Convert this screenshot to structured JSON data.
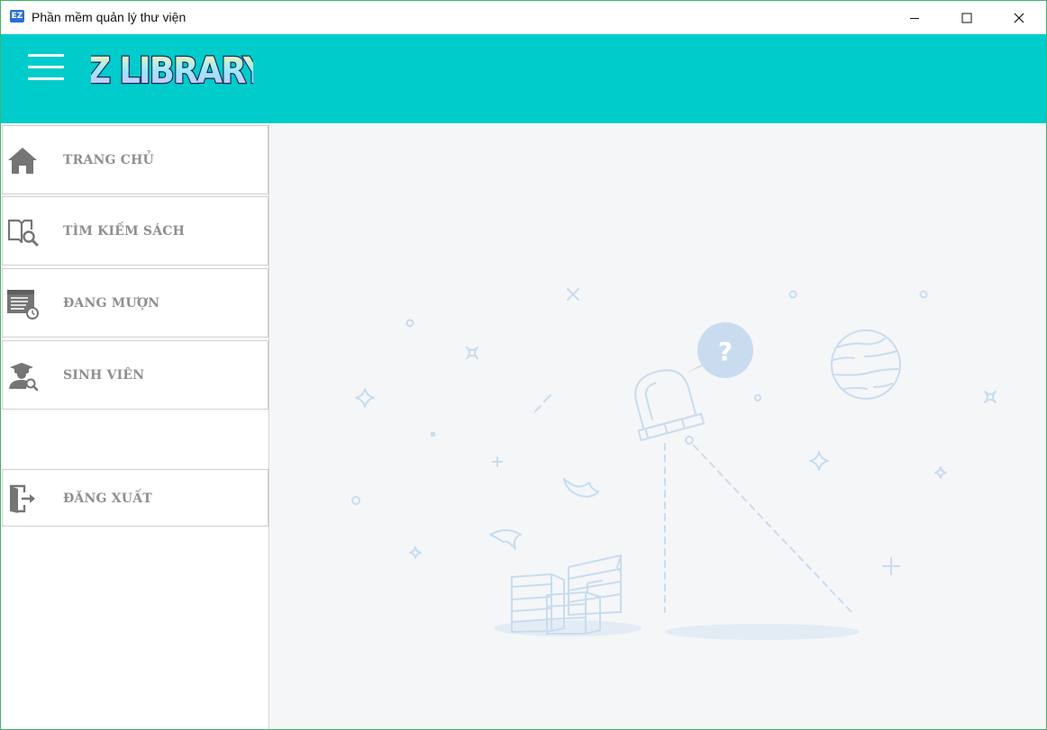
{
  "window": {
    "title": "Phần mềm quản lý thư viện",
    "icon_text": "EZ"
  },
  "header": {
    "logo_text": "EZ LIBRARY",
    "background": "#00cccc"
  },
  "sidebar": {
    "items": [
      {
        "label": "TRANG CHỦ",
        "icon": "home-icon"
      },
      {
        "label": "TÌM KIẾM SÁCH",
        "icon": "book-search-icon"
      },
      {
        "label": "ĐANG MƯỢN",
        "icon": "borrowed-list-icon"
      },
      {
        "label": "SINH VIÊN",
        "icon": "student-search-icon"
      }
    ],
    "logout": {
      "label": "ĐĂNG XUẤT",
      "icon": "logout-icon"
    }
  },
  "colors": {
    "accent": "#00cccc",
    "nav_text": "#8f8f8f",
    "main_background": "#f4f6f8",
    "illustration": "#c9dcef"
  }
}
